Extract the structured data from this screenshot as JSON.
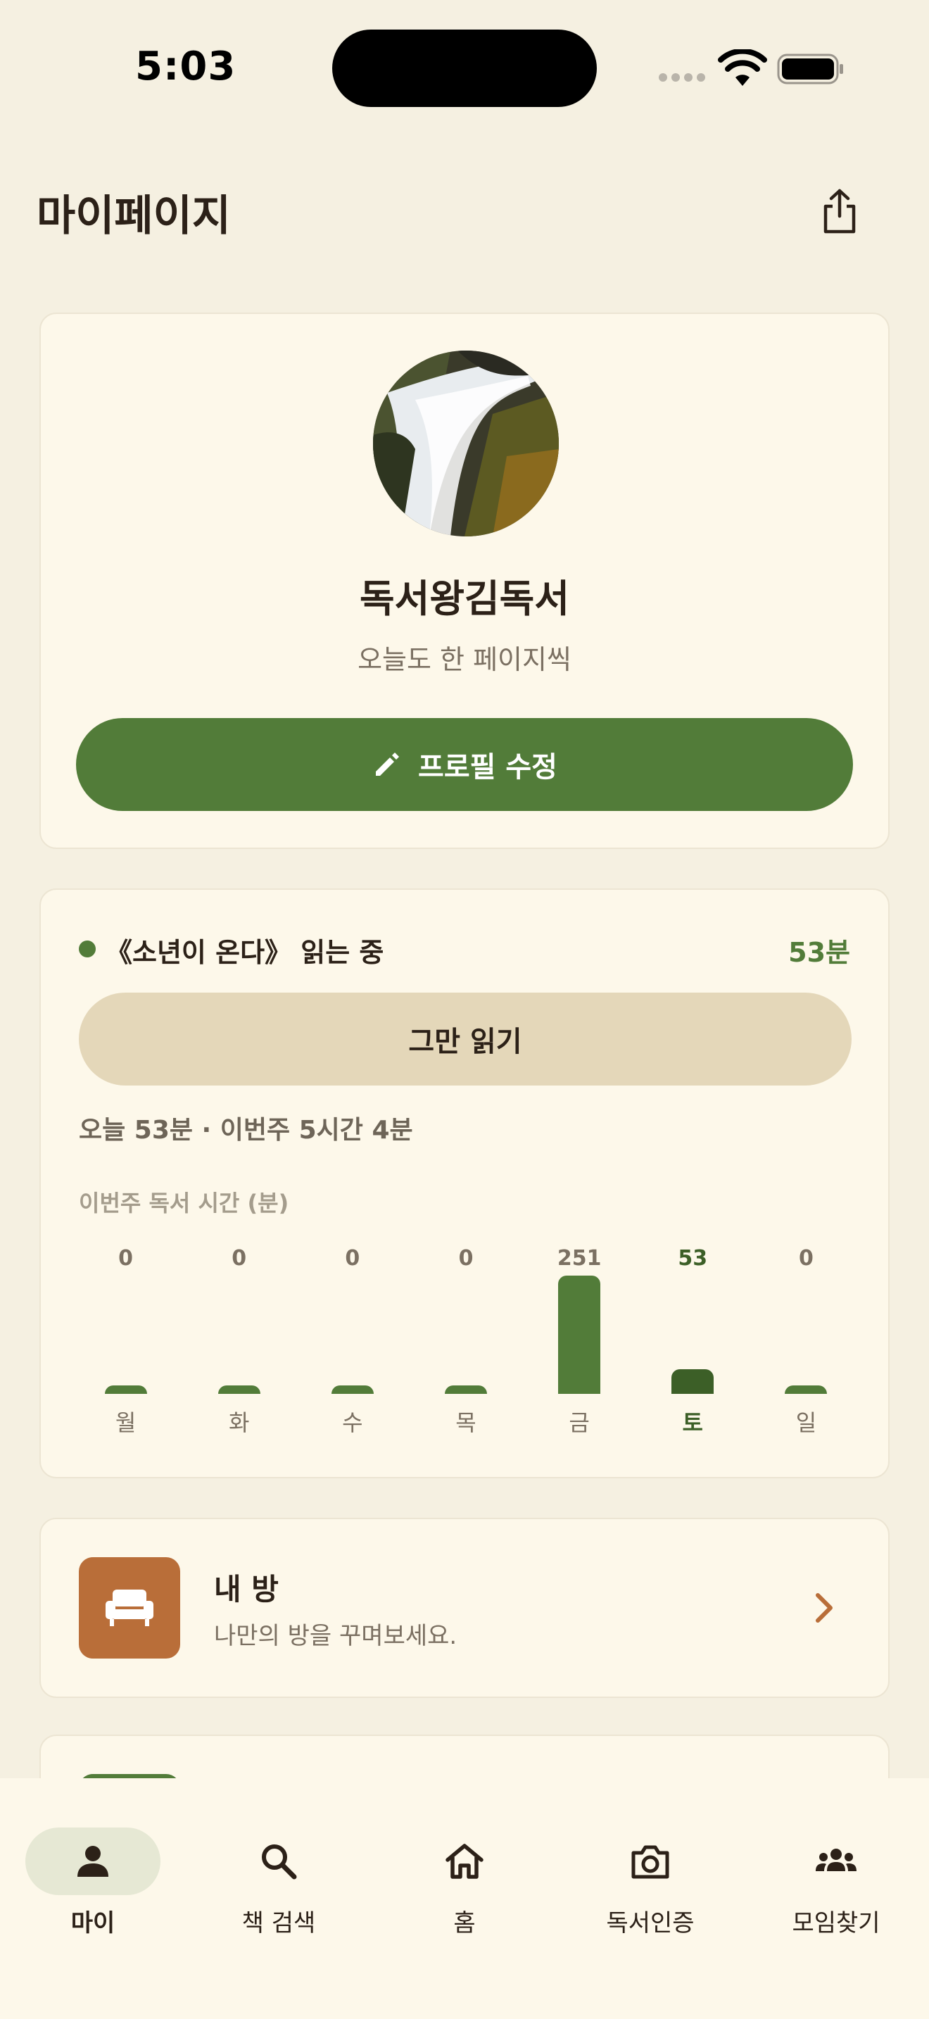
{
  "status_bar": {
    "time": "5:03"
  },
  "header": {
    "title": "마이페이지"
  },
  "profile": {
    "nickname": "독서왕김독서",
    "bio": "오늘도 한 페이지씩",
    "edit_label": "프로필 수정"
  },
  "reading": {
    "now_reading": "《소년이 온다》 읽는 중",
    "now_minutes": "53분",
    "stop_label": "그만 읽기",
    "summary": "오늘 53분 · 이번주 5시간 4분",
    "chart_title": "이번주 독서 시간 (분)"
  },
  "chart_data": {
    "type": "bar",
    "title": "이번주 독서 시간 (분)",
    "categories": [
      "월",
      "화",
      "수",
      "목",
      "금",
      "토",
      "일"
    ],
    "values": [
      0,
      0,
      0,
      0,
      251,
      53,
      0
    ],
    "value_labels": [
      "0",
      "0",
      "0",
      "0",
      "251",
      "53",
      "0"
    ],
    "highlight_index": 5,
    "ylim": [
      0,
      251
    ],
    "colors": {
      "bar": "#527c39",
      "highlight": "#3c5f27"
    }
  },
  "my_room": {
    "title": "내 방",
    "description": "나만의 방을 꾸며보세요."
  },
  "tabs": [
    {
      "label": "마이",
      "icon": "person-icon",
      "active": true
    },
    {
      "label": "책 검색",
      "icon": "search-icon",
      "active": false
    },
    {
      "label": "홈",
      "icon": "home-icon",
      "active": false
    },
    {
      "label": "독서인증",
      "icon": "camera-icon",
      "active": false
    },
    {
      "label": "모임찾기",
      "icon": "group-icon",
      "active": false
    }
  ],
  "colors": {
    "background": "#f5f0e1",
    "card": "#fdf8ea",
    "accent_green": "#527c39",
    "accent_brown": "#b96e39",
    "stop_button": "#e4d7b9"
  }
}
